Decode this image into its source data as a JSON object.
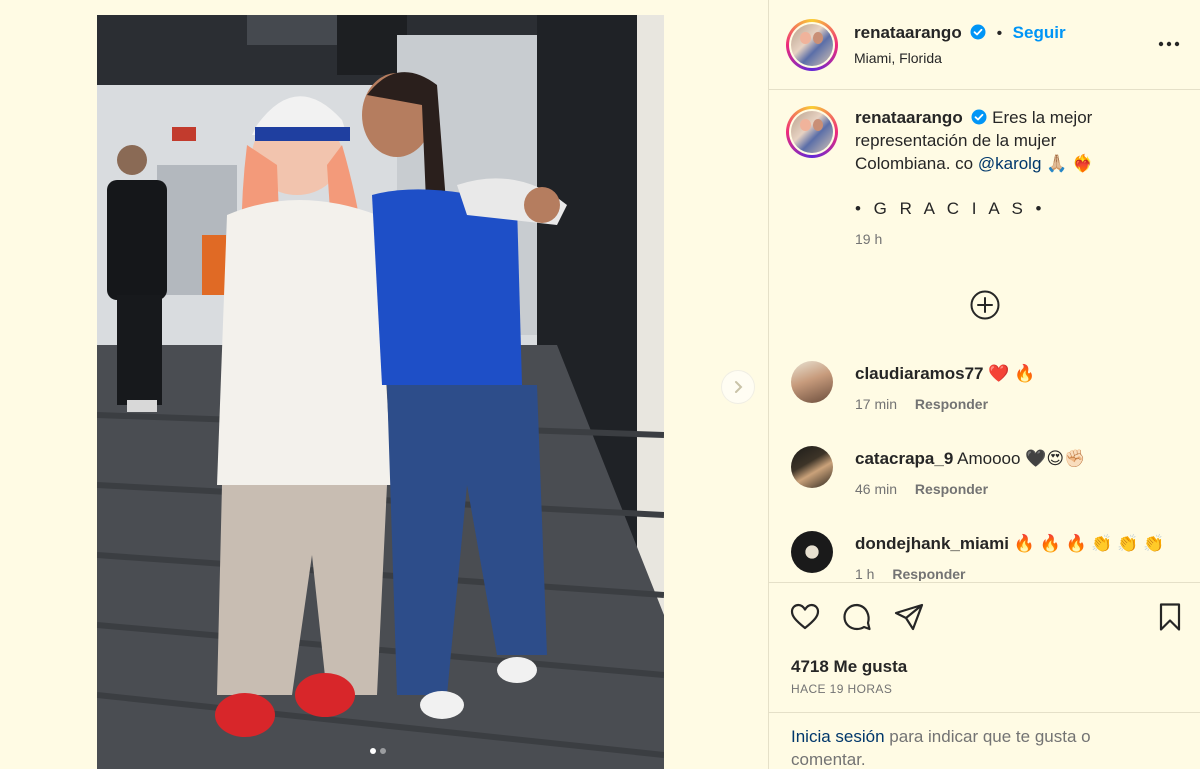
{
  "post": {
    "author": "renataarango",
    "follow_label": "Seguir",
    "location": "Miami, Florida",
    "caption_lines": [
      "Eres la mejor",
      "representación de la mujer",
      "Colombiana. co"
    ],
    "caption_mention": "@karolg",
    "caption_emojis": "🙏🏼 ❤️‍🔥",
    "caption_footer": "• G R A C I A S •",
    "posted_ago": "19 h",
    "separator": "•"
  },
  "comments": [
    {
      "user": "claudiaramos77",
      "text": "❤️ 🔥",
      "time": "17 min",
      "reply": "Responder"
    },
    {
      "user": "catacrapa_9",
      "text": "Amoooo 🖤😍✊🏻",
      "time": "46 min",
      "reply": "Responder"
    },
    {
      "user": "dondejhank_miami",
      "text": "🔥 🔥 🔥 👏 👏 👏",
      "time": "1 h",
      "reply": "Responder"
    }
  ],
  "stats": {
    "likes": "4718 Me gusta",
    "posted_full": "HACE 19 HORAS"
  },
  "login": {
    "link": "Inicia sesión",
    "rest": " para indicar que te gusta o comentar."
  },
  "carousel": {
    "current": 1,
    "total": 2
  },
  "colors": {
    "background": "#fffbe4",
    "accent": "#0095f6",
    "muted": "#737373"
  },
  "icons": [
    "verified-badge-icon",
    "more-options-icon",
    "add-circle-icon",
    "heart-icon",
    "comment-icon",
    "share-icon",
    "bookmark-icon",
    "chevron-right-icon"
  ]
}
